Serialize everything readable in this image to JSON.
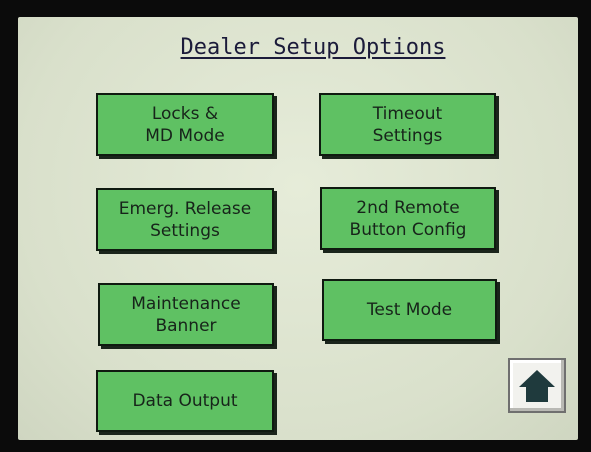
{
  "title": "Dealer Setup Options",
  "buttons": {
    "locks_md_mode": "Locks &\nMD Mode",
    "timeout_settings": "Timeout\nSettings",
    "emerg_release_settings": "Emerg. Release\nSettings",
    "second_remote_button_config": "2nd Remote\nButton Config",
    "maintenance_banner": "Maintenance\nBanner",
    "test_mode": "Test Mode",
    "data_output": "Data Output"
  },
  "home_button": {
    "icon": "home-icon"
  },
  "colors": {
    "button_green": "#5fc163",
    "screen_background": "#dfe6d2",
    "bezel": "#0b0b0b",
    "home_icon": "#1f3a3d"
  }
}
